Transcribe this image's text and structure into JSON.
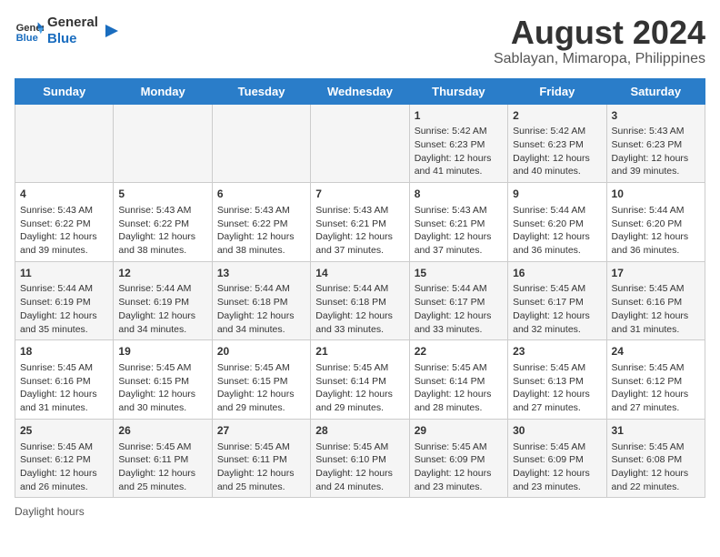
{
  "header": {
    "logo_line1": "General",
    "logo_line2": "Blue",
    "main_title": "August 2024",
    "subtitle": "Sablayan, Mimaropa, Philippines"
  },
  "days_of_week": [
    "Sunday",
    "Monday",
    "Tuesday",
    "Wednesday",
    "Thursday",
    "Friday",
    "Saturday"
  ],
  "weeks": [
    [
      {
        "day": "",
        "info": ""
      },
      {
        "day": "",
        "info": ""
      },
      {
        "day": "",
        "info": ""
      },
      {
        "day": "",
        "info": ""
      },
      {
        "day": "1",
        "info": "Sunrise: 5:42 AM\nSunset: 6:23 PM\nDaylight: 12 hours and 41 minutes."
      },
      {
        "day": "2",
        "info": "Sunrise: 5:42 AM\nSunset: 6:23 PM\nDaylight: 12 hours and 40 minutes."
      },
      {
        "day": "3",
        "info": "Sunrise: 5:43 AM\nSunset: 6:23 PM\nDaylight: 12 hours and 39 minutes."
      }
    ],
    [
      {
        "day": "4",
        "info": "Sunrise: 5:43 AM\nSunset: 6:22 PM\nDaylight: 12 hours and 39 minutes."
      },
      {
        "day": "5",
        "info": "Sunrise: 5:43 AM\nSunset: 6:22 PM\nDaylight: 12 hours and 38 minutes."
      },
      {
        "day": "6",
        "info": "Sunrise: 5:43 AM\nSunset: 6:22 PM\nDaylight: 12 hours and 38 minutes."
      },
      {
        "day": "7",
        "info": "Sunrise: 5:43 AM\nSunset: 6:21 PM\nDaylight: 12 hours and 37 minutes."
      },
      {
        "day": "8",
        "info": "Sunrise: 5:43 AM\nSunset: 6:21 PM\nDaylight: 12 hours and 37 minutes."
      },
      {
        "day": "9",
        "info": "Sunrise: 5:44 AM\nSunset: 6:20 PM\nDaylight: 12 hours and 36 minutes."
      },
      {
        "day": "10",
        "info": "Sunrise: 5:44 AM\nSunset: 6:20 PM\nDaylight: 12 hours and 36 minutes."
      }
    ],
    [
      {
        "day": "11",
        "info": "Sunrise: 5:44 AM\nSunset: 6:19 PM\nDaylight: 12 hours and 35 minutes."
      },
      {
        "day": "12",
        "info": "Sunrise: 5:44 AM\nSunset: 6:19 PM\nDaylight: 12 hours and 34 minutes."
      },
      {
        "day": "13",
        "info": "Sunrise: 5:44 AM\nSunset: 6:18 PM\nDaylight: 12 hours and 34 minutes."
      },
      {
        "day": "14",
        "info": "Sunrise: 5:44 AM\nSunset: 6:18 PM\nDaylight: 12 hours and 33 minutes."
      },
      {
        "day": "15",
        "info": "Sunrise: 5:44 AM\nSunset: 6:17 PM\nDaylight: 12 hours and 33 minutes."
      },
      {
        "day": "16",
        "info": "Sunrise: 5:45 AM\nSunset: 6:17 PM\nDaylight: 12 hours and 32 minutes."
      },
      {
        "day": "17",
        "info": "Sunrise: 5:45 AM\nSunset: 6:16 PM\nDaylight: 12 hours and 31 minutes."
      }
    ],
    [
      {
        "day": "18",
        "info": "Sunrise: 5:45 AM\nSunset: 6:16 PM\nDaylight: 12 hours and 31 minutes."
      },
      {
        "day": "19",
        "info": "Sunrise: 5:45 AM\nSunset: 6:15 PM\nDaylight: 12 hours and 30 minutes."
      },
      {
        "day": "20",
        "info": "Sunrise: 5:45 AM\nSunset: 6:15 PM\nDaylight: 12 hours and 29 minutes."
      },
      {
        "day": "21",
        "info": "Sunrise: 5:45 AM\nSunset: 6:14 PM\nDaylight: 12 hours and 29 minutes."
      },
      {
        "day": "22",
        "info": "Sunrise: 5:45 AM\nSunset: 6:14 PM\nDaylight: 12 hours and 28 minutes."
      },
      {
        "day": "23",
        "info": "Sunrise: 5:45 AM\nSunset: 6:13 PM\nDaylight: 12 hours and 27 minutes."
      },
      {
        "day": "24",
        "info": "Sunrise: 5:45 AM\nSunset: 6:12 PM\nDaylight: 12 hours and 27 minutes."
      }
    ],
    [
      {
        "day": "25",
        "info": "Sunrise: 5:45 AM\nSunset: 6:12 PM\nDaylight: 12 hours and 26 minutes."
      },
      {
        "day": "26",
        "info": "Sunrise: 5:45 AM\nSunset: 6:11 PM\nDaylight: 12 hours and 25 minutes."
      },
      {
        "day": "27",
        "info": "Sunrise: 5:45 AM\nSunset: 6:11 PM\nDaylight: 12 hours and 25 minutes."
      },
      {
        "day": "28",
        "info": "Sunrise: 5:45 AM\nSunset: 6:10 PM\nDaylight: 12 hours and 24 minutes."
      },
      {
        "day": "29",
        "info": "Sunrise: 5:45 AM\nSunset: 6:09 PM\nDaylight: 12 hours and 23 minutes."
      },
      {
        "day": "30",
        "info": "Sunrise: 5:45 AM\nSunset: 6:09 PM\nDaylight: 12 hours and 23 minutes."
      },
      {
        "day": "31",
        "info": "Sunrise: 5:45 AM\nSunset: 6:08 PM\nDaylight: 12 hours and 22 minutes."
      }
    ]
  ],
  "footer": {
    "daylight_label": "Daylight hours"
  }
}
